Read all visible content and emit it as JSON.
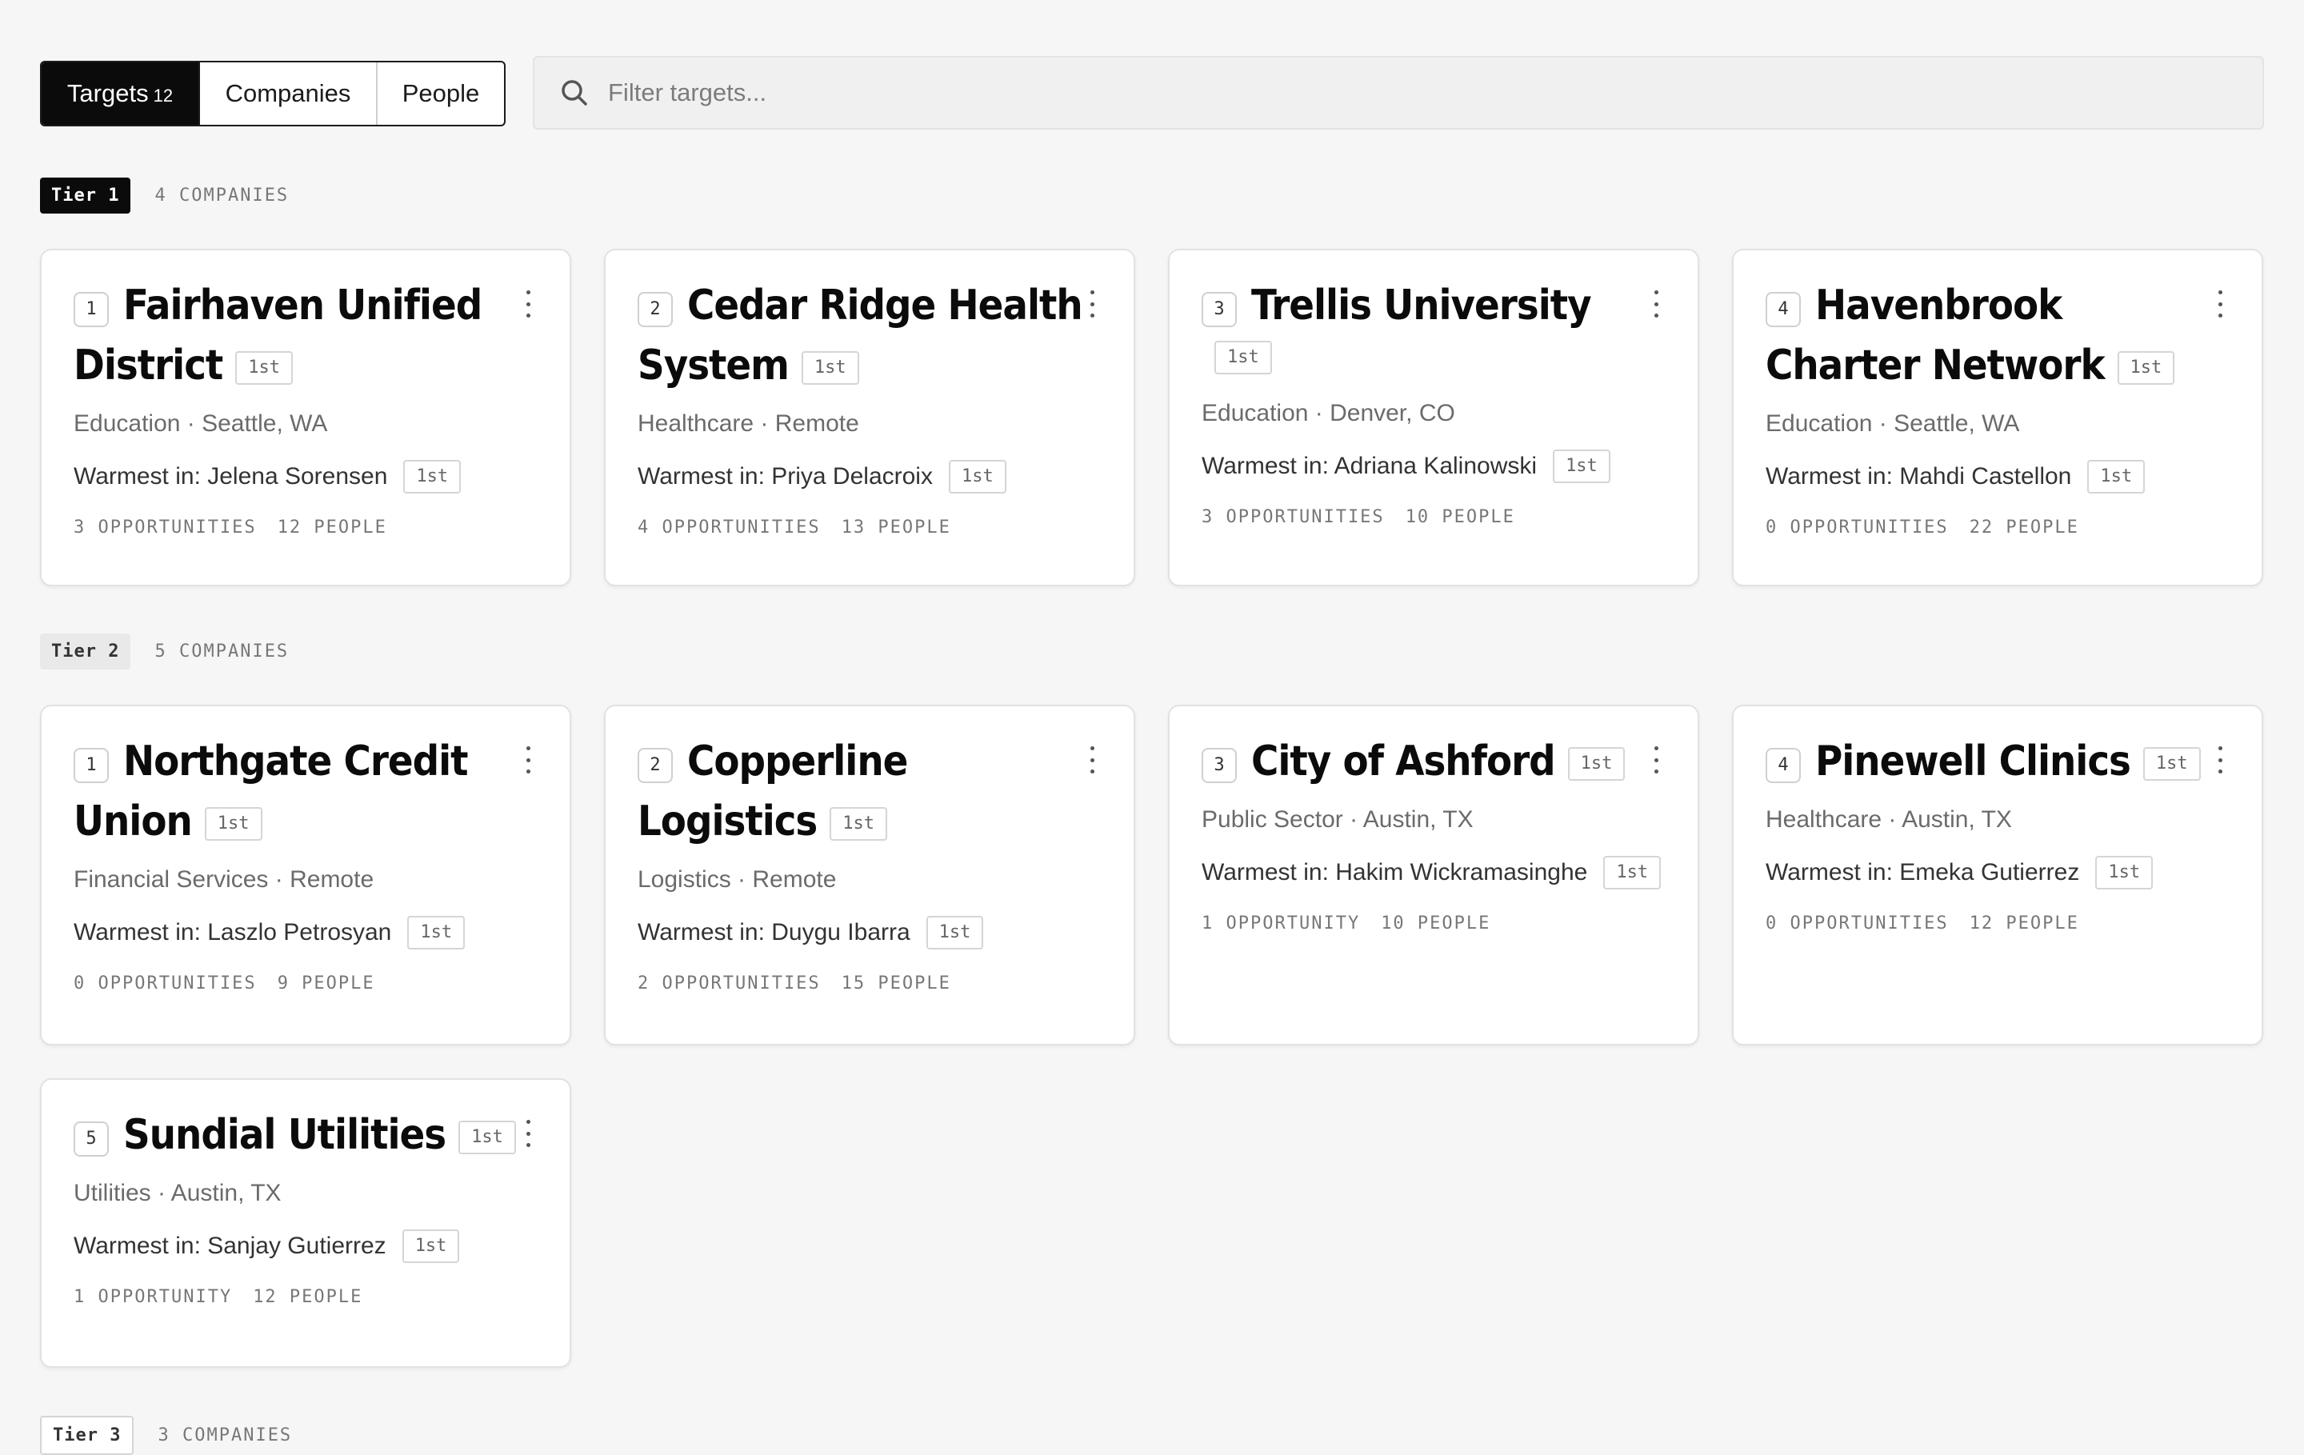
{
  "toolbar": {
    "tabs": [
      {
        "label": "Targets",
        "count": "12",
        "active": true
      },
      {
        "label": "Companies",
        "active": false
      },
      {
        "label": "People",
        "active": false
      }
    ],
    "search_placeholder": "Filter targets..."
  },
  "tiers": [
    {
      "label": "Tier 1",
      "count_label": "4 COMPANIES",
      "cards": [
        {
          "rank": "1",
          "name": "Fairhaven Unified District",
          "degree": "1st",
          "meta": "Education · Seattle, WA",
          "warmest": "Warmest in: Jelena Sorensen",
          "warm_degree": "1st",
          "opportunities": "3 OPPORTUNITIES",
          "people": "12 PEOPLE"
        },
        {
          "rank": "2",
          "name": "Cedar Ridge Health System",
          "degree": "1st",
          "meta": "Healthcare · Remote",
          "warmest": "Warmest in: Priya Delacroix",
          "warm_degree": "1st",
          "opportunities": "4 OPPORTUNITIES",
          "people": "13 PEOPLE"
        },
        {
          "rank": "3",
          "name": "Trellis University",
          "degree": "1st",
          "meta": "Education · Denver, CO",
          "warmest": "Warmest in: Adriana Kalinowski",
          "warm_degree": "1st",
          "opportunities": "3 OPPORTUNITIES",
          "people": "10 PEOPLE"
        },
        {
          "rank": "4",
          "name": "Havenbrook Charter Network",
          "degree": "1st",
          "meta": "Education · Seattle, WA",
          "warmest": "Warmest in: Mahdi Castellon",
          "warm_degree": "1st",
          "opportunities": "0 OPPORTUNITIES",
          "people": "22 PEOPLE"
        }
      ]
    },
    {
      "label": "Tier 2",
      "count_label": "5 COMPANIES",
      "cards": [
        {
          "rank": "1",
          "name": "Northgate Credit Union",
          "degree": "1st",
          "meta": "Financial Services · Remote",
          "warmest": "Warmest in: Laszlo Petrosyan",
          "warm_degree": "1st",
          "opportunities": "0 OPPORTUNITIES",
          "people": "9 PEOPLE"
        },
        {
          "rank": "2",
          "name": "Copperline Logistics",
          "degree": "1st",
          "meta": "Logistics · Remote",
          "warmest": "Warmest in: Duygu Ibarra",
          "warm_degree": "1st",
          "opportunities": "2 OPPORTUNITIES",
          "people": "15 PEOPLE"
        },
        {
          "rank": "3",
          "name": "City of Ashford",
          "degree": "1st",
          "meta": "Public Sector · Austin, TX",
          "warmest": "Warmest in: Hakim Wickramasinghe",
          "warm_degree": "1st",
          "opportunities": "1 OPPORTUNITY",
          "people": "10 PEOPLE"
        },
        {
          "rank": "4",
          "name": "Pinewell Clinics",
          "degree": "1st",
          "meta": "Healthcare · Austin, TX",
          "warmest": "Warmest in: Emeka Gutierrez",
          "warm_degree": "1st",
          "opportunities": "0 OPPORTUNITIES",
          "people": "12 PEOPLE"
        },
        {
          "rank": "5",
          "name": "Sundial Utilities",
          "degree": "1st",
          "meta": "Utilities · Austin, TX",
          "warmest": "Warmest in: Sanjay Gutierrez",
          "warm_degree": "1st",
          "opportunities": "1 OPPORTUNITY",
          "people": "12 PEOPLE"
        }
      ]
    },
    {
      "label": "Tier 3",
      "count_label": "3 COMPANIES",
      "cards": []
    }
  ]
}
